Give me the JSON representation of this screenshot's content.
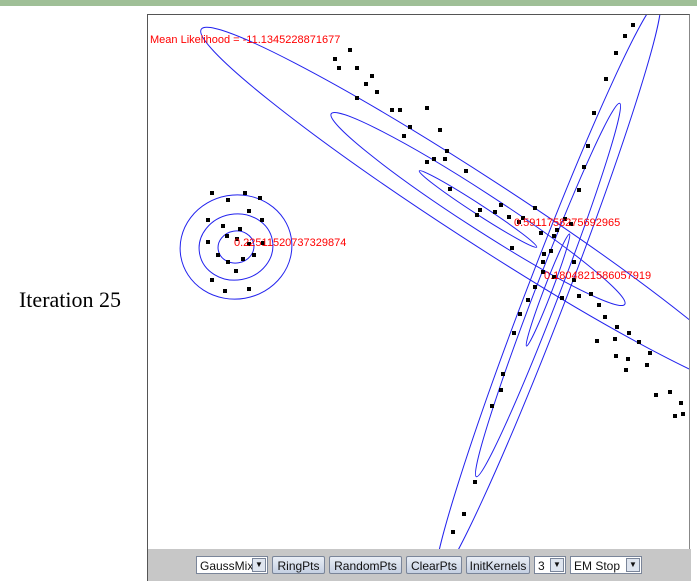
{
  "slide": {
    "label": "Iteration 25"
  },
  "plot": {
    "likelihood_text": "Mean Likelihood = -11.1345228871677",
    "kernel_labels": [
      "0.2251152073732987 4",
      "0.5911758275692965",
      "0.1804821586057919"
    ],
    "kernel_label_text": [
      "0.22511520737329874",
      "0.5911758275692965",
      "0.1804821586057919"
    ],
    "colors": {
      "text": "#ff0000",
      "contour": "#0000ff",
      "point": "#000000"
    }
  },
  "toolbar": {
    "mode_select": "GaussMix",
    "ring_pts": "RingPts",
    "random_pts": "RandomPts",
    "clear_pts": "ClearPts",
    "init_kernels": "InitKernels",
    "kernel_count": "3",
    "em_state": "EM Stop"
  }
}
